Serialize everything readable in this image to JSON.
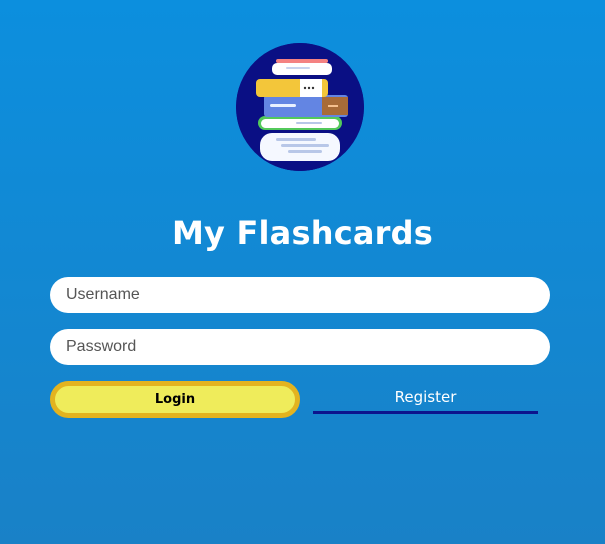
{
  "app": {
    "title": "My Flashcards",
    "logo_icon": "flashcards-books-icon"
  },
  "form": {
    "username_placeholder": "Username",
    "username_value": "",
    "password_placeholder": "Password",
    "password_value": "",
    "login_label": "Login",
    "register_label": "Register"
  },
  "colors": {
    "background_top": "#0c8fde",
    "background_bottom": "#1981c7",
    "logo_circle": "#0a0f84",
    "login_fill": "#efec5b",
    "login_border": "#e3b31f",
    "register_underline": "#0c148d"
  }
}
